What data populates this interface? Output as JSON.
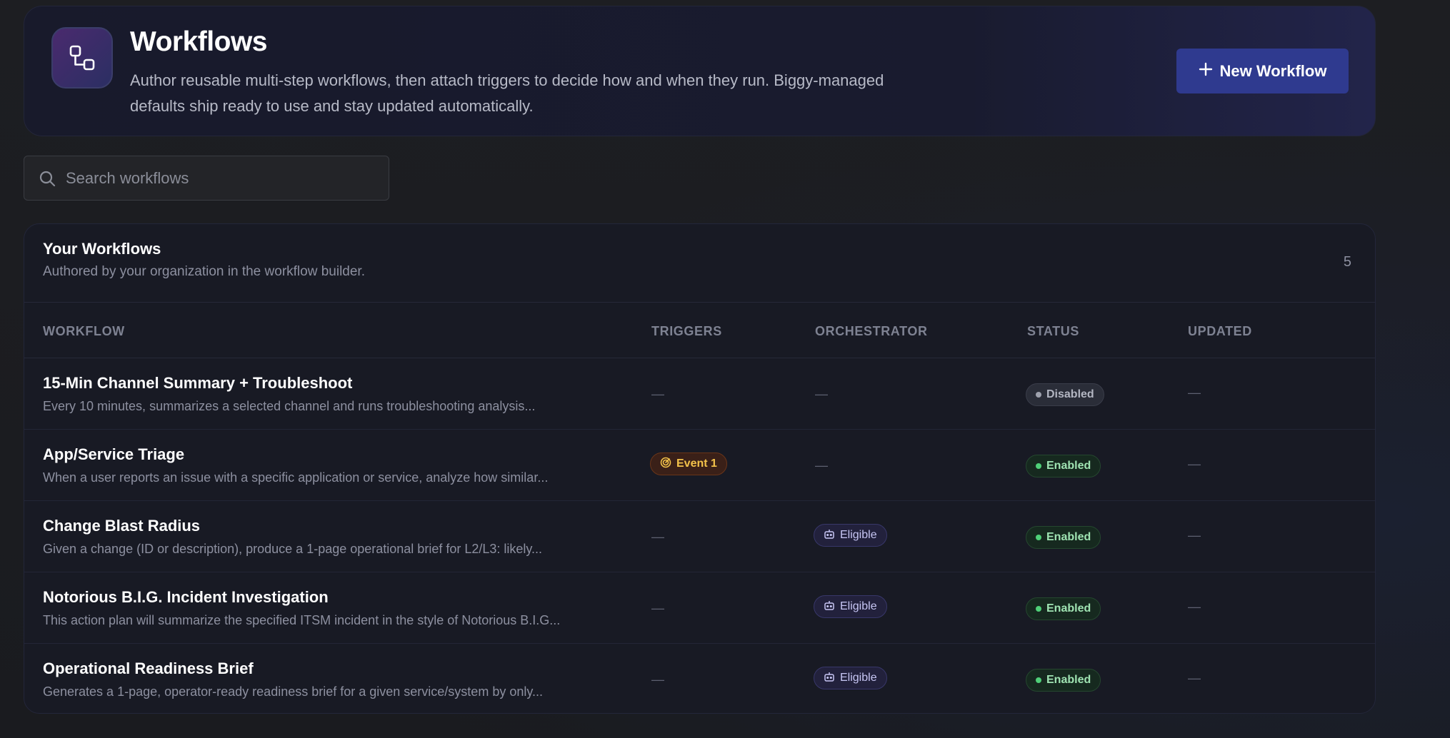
{
  "header": {
    "title": "Workflows",
    "description": "Author reusable multi-step workflows, then attach triggers to decide how and when they run. Biggy-managed defaults ship ready to use and stay updated automatically.",
    "new_button_label": "New Workflow",
    "icon": "workflow-icon"
  },
  "search": {
    "placeholder": "Search workflows",
    "value": ""
  },
  "panel": {
    "title": "Your Workflows",
    "subtitle": "Authored by your organization in the workflow builder.",
    "count": "5"
  },
  "columns": {
    "workflow": "WORKFLOW",
    "triggers": "TRIGGERS",
    "orchestrator": "ORCHESTRATOR",
    "status": "STATUS",
    "updated": "UPDATED"
  },
  "rows": [
    {
      "name": "15-Min Channel Summary + Troubleshoot",
      "description": "Every 10 minutes, summarizes a selected channel and runs troubleshooting analysis...",
      "triggers": "—",
      "orchestrator": "—",
      "status": "Disabled",
      "updated": "—"
    },
    {
      "name": "App/Service Triage",
      "description": "When a user reports an issue with a specific application or service, analyze how similar...",
      "triggers": "Event 1",
      "orchestrator": "—",
      "status": "Enabled",
      "updated": "—"
    },
    {
      "name": "Change Blast Radius",
      "description": "Given a change (ID or description), produce a 1-page operational brief for L2/L3: likely...",
      "triggers": "—",
      "orchestrator": "Eligible",
      "status": "Enabled",
      "updated": "—"
    },
    {
      "name": "Notorious B.I.G. Incident Investigation",
      "description": "This action plan will summarize the specified ITSM incident in the style of Notorious B.I.G...",
      "triggers": "—",
      "orchestrator": "Eligible",
      "status": "Enabled",
      "updated": "—"
    },
    {
      "name": "Operational Readiness Brief",
      "description": "Generates a 1-page, operator-ready readiness brief for a given service/system by only...",
      "triggers": "—",
      "orchestrator": "Eligible",
      "status": "Enabled",
      "updated": "—"
    }
  ],
  "colors": {
    "accent": "#2f3a8f",
    "enabled": "#4fcf78",
    "disabled": "#9ea1ad",
    "event": "#f3c24a",
    "eligible": "#c7c6f4"
  }
}
